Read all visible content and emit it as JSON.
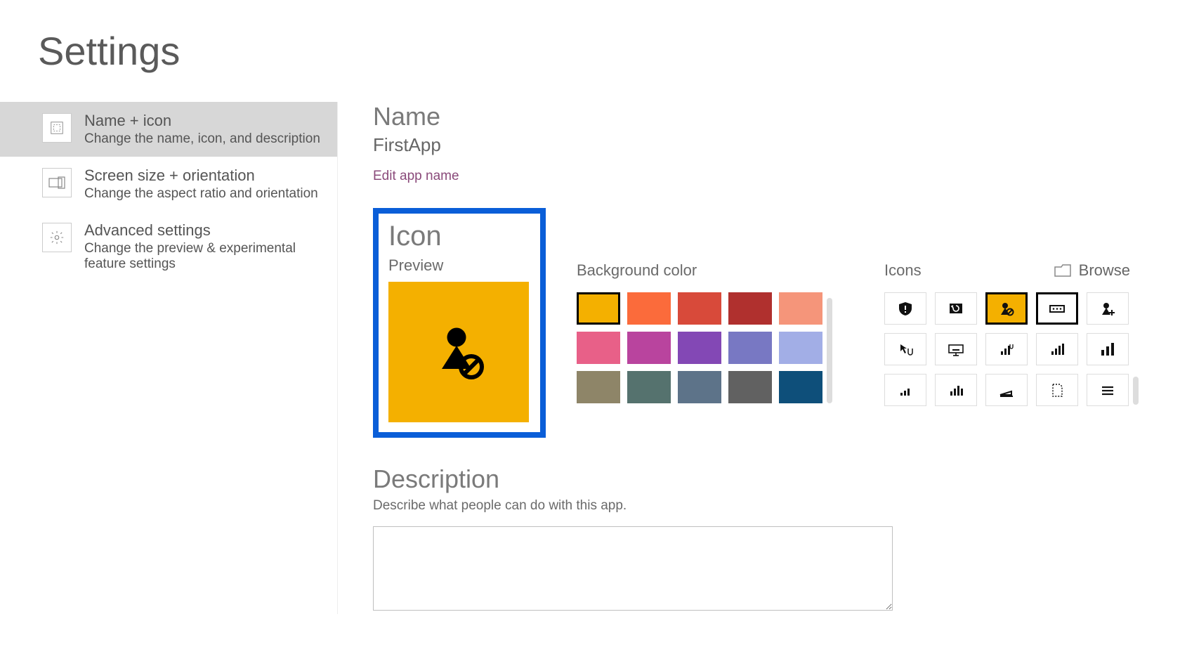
{
  "page_title": "Settings",
  "sidebar": {
    "items": [
      {
        "title": "Name + icon",
        "subtitle": "Change the name, icon, and description",
        "icon": "layout-icon",
        "selected": true
      },
      {
        "title": "Screen size + orientation",
        "subtitle": "Change the aspect ratio and orientation",
        "icon": "screen-icon",
        "selected": false
      },
      {
        "title": "Advanced settings",
        "subtitle": "Change the preview & experimental feature settings",
        "icon": "gear-icon",
        "selected": false
      }
    ]
  },
  "name": {
    "heading": "Name",
    "app_name": "FirstApp",
    "edit_link": "Edit app name"
  },
  "icon": {
    "heading": "Icon",
    "preview_label": "Preview",
    "bg_label": "Background color",
    "colors": [
      "#f4b000",
      "#fb6b3b",
      "#d84a3a",
      "#b0302e",
      "#f5957a",
      "#e86088",
      "#b9449e",
      "#8348b5",
      "#7878c3",
      "#a2aee6",
      "#8e8568",
      "#55726e",
      "#5d7389",
      "#616161",
      "#0e4f7a"
    ],
    "selected_color_index": 0,
    "icons_label": "Icons",
    "browse_label": "Browse",
    "icon_list": [
      "shield-alert",
      "refresh-image",
      "user-blocked",
      "card-dots",
      "user-add",
      "cursor-hand",
      "keyboard",
      "bars-hand",
      "bars-up",
      "bars-tall",
      "bars-small",
      "bars-med",
      "scan-wedge",
      "page-dotted",
      "menu-lines"
    ],
    "selected_icon_index": 2,
    "outlined_icon_index": 3
  },
  "description": {
    "heading": "Description",
    "hint": "Describe what people can do with this app.",
    "value": ""
  }
}
